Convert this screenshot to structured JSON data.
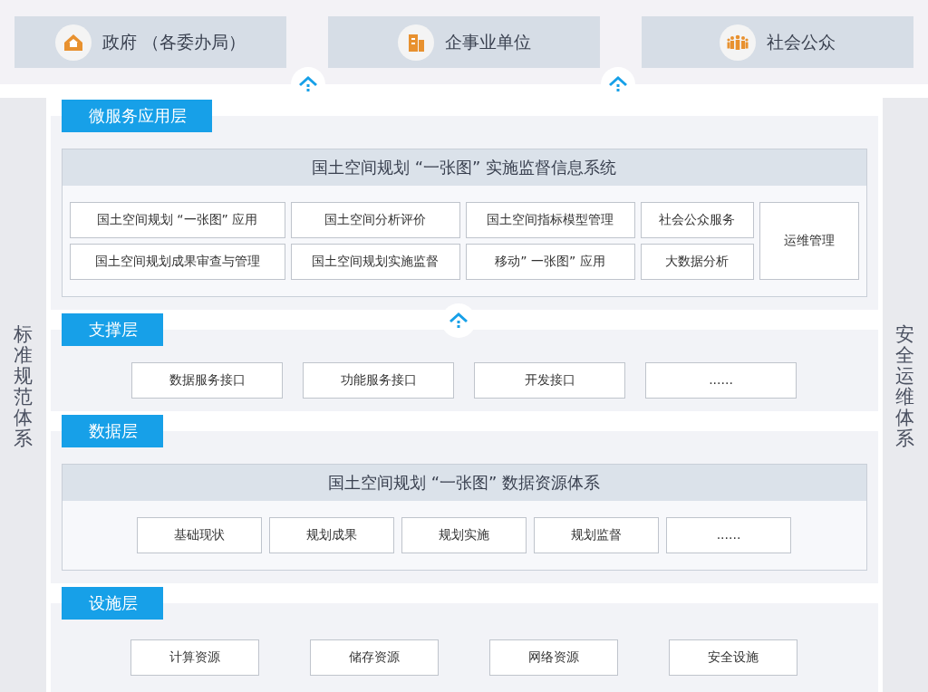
{
  "user_groups": [
    {
      "label": "政府 （各委办局）"
    },
    {
      "label": "企事业单位"
    },
    {
      "label": "社会公众"
    }
  ],
  "side_left": "标准规范体系",
  "side_right": "安全运维体系",
  "layers": [
    {
      "kind": "apps",
      "title": "微服务应用层",
      "system_title": "国土空间规划 “一张图” 实施监督信息系统",
      "items": [
        "国土空间规划 “一张图” 应用",
        "国土空间分析评价",
        "国土空间指标模型管理",
        "社会公众服务",
        "国土空间规划成果审查与管理",
        "国土空间规划实施监督",
        "移动” 一张图” 应用",
        "大数据分析"
      ],
      "side_item": "运维管理"
    },
    {
      "kind": "boxes",
      "title": "支撑层",
      "items": [
        "数据服务接口",
        "功能服务接口",
        "开发接口",
        "......"
      ]
    },
    {
      "kind": "system",
      "title": "数据层",
      "system_title": "国土空间规划 “一张图” 数据资源体系",
      "items": [
        "基础现状",
        "规划成果",
        "规划实施",
        "规划监督",
        "......"
      ]
    },
    {
      "kind": "boxes",
      "title": "设施层",
      "items": [
        "计算资源",
        "储存资源",
        "网络资源",
        "安全设施"
      ]
    }
  ]
}
